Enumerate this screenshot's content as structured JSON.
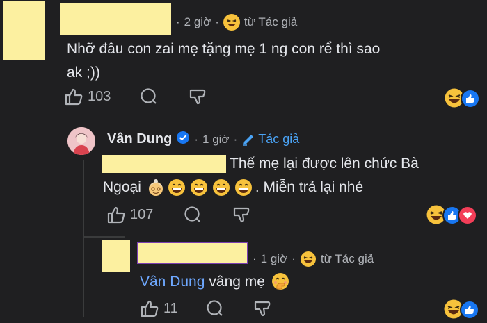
{
  "comment1": {
    "time": "2 giờ",
    "from_author": "từ Tác giả",
    "text_line1": "Nhỡ đâu con zai mẹ tặng mẹ 1 ng con rể thì sao",
    "text_line2": "ak ;))",
    "likes": "103"
  },
  "reply1": {
    "name": "Vân Dung",
    "time": "1 giờ",
    "author_tag": "Tác giả",
    "text_line1": "Thế mẹ lại được lên chức Bà",
    "text_line2_a": "Ngoại",
    "text_line2_b": ". Miễn trả lại nhé",
    "likes": "107"
  },
  "reply2": {
    "time": "1 giờ",
    "from_author": "từ Tác giả",
    "mention": "Vân Dung",
    "text": "vâng mẹ",
    "likes": "11"
  },
  "colors": {
    "background": "#1f1f21",
    "text": "#e4e6eb",
    "muted": "#b0b3b8",
    "link_blue": "#4aa3f5",
    "highlight_yellow": "#fcf0a0",
    "verified_blue": "#1877f2"
  }
}
